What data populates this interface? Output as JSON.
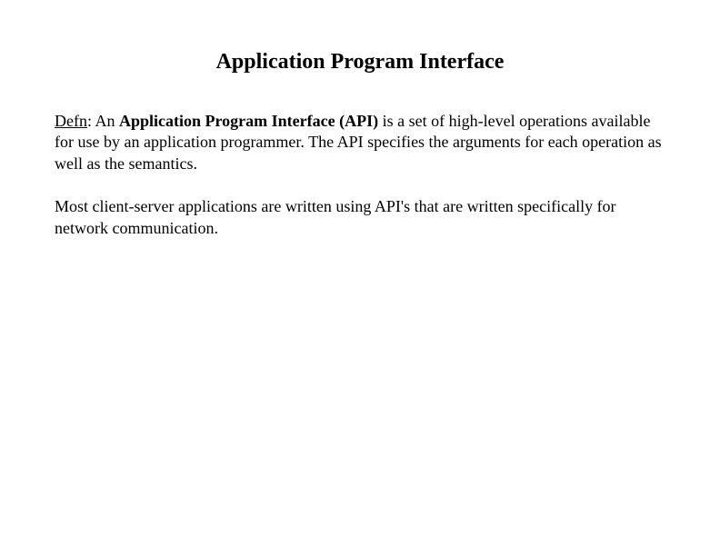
{
  "title": "Application Program Interface",
  "definition": {
    "label": "Defn",
    "colon": ": An ",
    "term": "Application Program Interface (API)",
    "rest": " is a set of high-level operations available for use by an application programmer. The API specifies the arguments for each operation as well as the semantics."
  },
  "paragraph2": "Most client-server applications are written using API's that are written specifically for network communication."
}
